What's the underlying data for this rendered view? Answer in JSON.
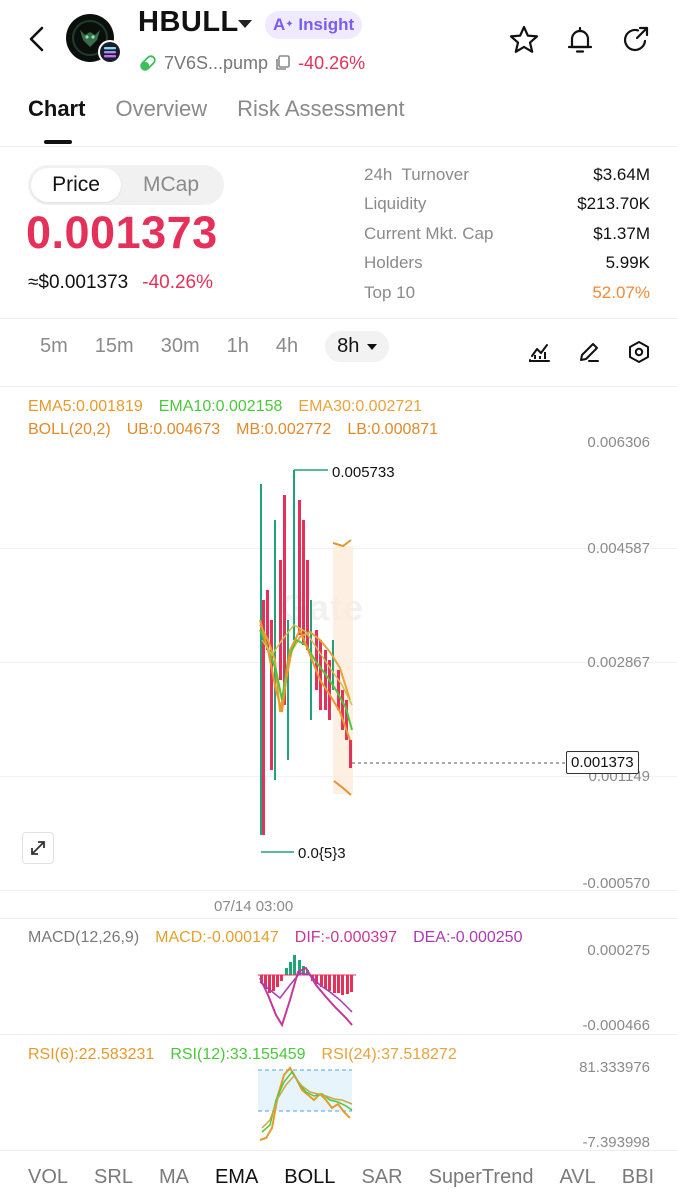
{
  "header": {
    "title": "HBULL",
    "insight_label": "Insight",
    "address": "7V6S...pump",
    "change": "-40.26%"
  },
  "tabs": [
    {
      "label": "Chart",
      "active": true
    },
    {
      "label": "Overview",
      "active": false
    },
    {
      "label": "Risk Assessment",
      "active": false
    }
  ],
  "price_panel": {
    "toggle": [
      "Price",
      "MCap"
    ],
    "price": "0.001373",
    "usd_price": "≈$0.001373",
    "usd_change": "-40.26%"
  },
  "stats": [
    {
      "label": "24h  Turnover",
      "value": "$3.64M"
    },
    {
      "label": "Liquidity",
      "value": "$213.70K"
    },
    {
      "label": "Current Mkt. Cap",
      "value": "$1.37M"
    },
    {
      "label": "Holders",
      "value": "5.99K"
    },
    {
      "label": "Top 10",
      "value": "52.07%"
    }
  ],
  "intervals": [
    "5m",
    "15m",
    "30m",
    "1h",
    "4h",
    "8h"
  ],
  "active_interval": "8h",
  "indicators": {
    "ema5": "EMA5:0.001819",
    "ema10": "EMA10:0.002158",
    "ema30": "EMA30:0.002721",
    "boll": "BOLL(20,2)",
    "ub": "UB:0.004673",
    "mb": "MB:0.002772",
    "lb": "LB:0.000871",
    "macd_params": "MACD(12,26,9)",
    "macd": "MACD:-0.000147",
    "dif": "DIF:-0.000397",
    "dea": "DEA:-0.000250",
    "rsi6": "RSI(6):22.583231",
    "rsi12": "RSI(12):33.155459",
    "rsi24": "RSI(24):37.518272"
  },
  "price_axis": [
    "0.006306",
    "0.004587",
    "0.002867",
    "0.001149",
    "-0.000570"
  ],
  "macd_axis": [
    "0.000275",
    "-0.000466"
  ],
  "rsi_axis": [
    "81.333976",
    "-7.393998"
  ],
  "chart_labels": {
    "high": "0.005733",
    "low": "0.0{5}3",
    "current": "0.001373",
    "date": "07/14 03:00",
    "watermark": "Gate"
  },
  "bottom_indicators": [
    "VOL",
    "SRL",
    "MA",
    "EMA",
    "BOLL",
    "SAR",
    "SuperTrend",
    "AVL",
    "BBI"
  ],
  "colors": {
    "down": "#e5315a",
    "up": "#1fa37a",
    "accent": "#7b5cf0",
    "warn": "#ef8a3a"
  }
}
